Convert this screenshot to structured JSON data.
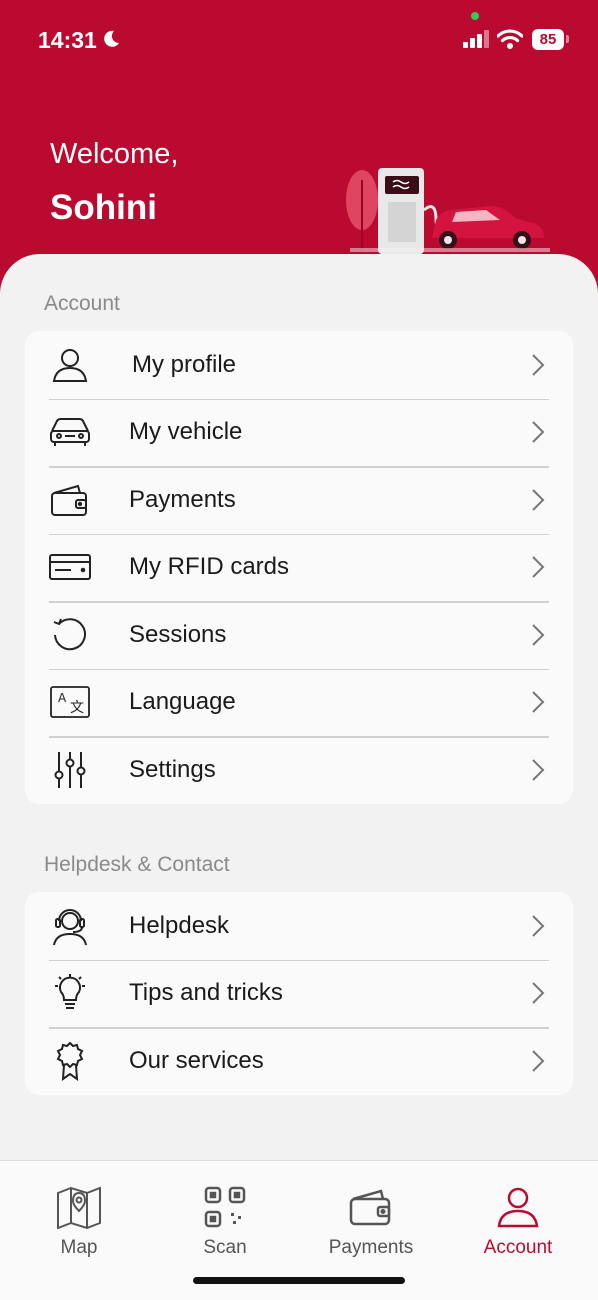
{
  "status_bar": {
    "time": "14:31",
    "battery": "85"
  },
  "header": {
    "welcome": "Welcome,",
    "username": "Sohini",
    "accent_color": "#bb0a30"
  },
  "account_section": {
    "title": "Account",
    "items": [
      {
        "label": "My profile",
        "icon": "person-icon"
      },
      {
        "label": "My vehicle",
        "icon": "car-icon"
      },
      {
        "label": "Payments",
        "icon": "wallet-icon"
      },
      {
        "label": "My RFID cards",
        "icon": "card-icon"
      },
      {
        "label": "Sessions",
        "icon": "refresh-icon"
      },
      {
        "label": "Language",
        "icon": "translate-icon"
      },
      {
        "label": "Settings",
        "icon": "sliders-icon"
      }
    ]
  },
  "help_section": {
    "title": "Helpdesk & Contact",
    "items": [
      {
        "label": "Helpdesk",
        "icon": "headset-icon"
      },
      {
        "label": "Tips and tricks",
        "icon": "lightbulb-icon"
      },
      {
        "label": "Our services",
        "icon": "badge-icon"
      }
    ]
  },
  "tabbar": {
    "tabs": [
      {
        "label": "Map",
        "icon": "map-icon",
        "active": false
      },
      {
        "label": "Scan",
        "icon": "qr-icon",
        "active": false
      },
      {
        "label": "Payments",
        "icon": "wallet-icon",
        "active": false
      },
      {
        "label": "Account",
        "icon": "person-icon",
        "active": true
      }
    ]
  }
}
